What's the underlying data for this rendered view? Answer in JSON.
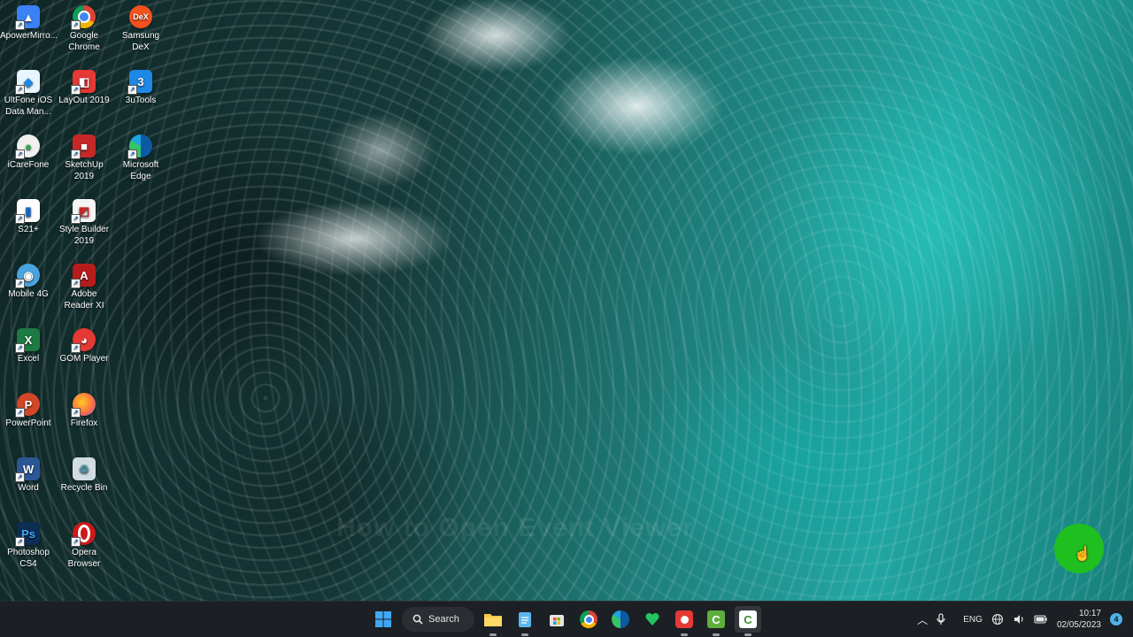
{
  "desktop": {
    "icons": [
      {
        "label": "ApowerMirro...",
        "icon": "apowermirror-icon"
      },
      {
        "label": "Google Chrome",
        "icon": "chrome-icon"
      },
      {
        "label": "Samsung DeX",
        "icon": "samsung-dex-icon"
      },
      {
        "label": "UltFone iOS Data Man...",
        "icon": "ultfone-icon"
      },
      {
        "label": "LayOut 2019",
        "icon": "layout-icon"
      },
      {
        "label": "3uTools",
        "icon": "3utools-icon"
      },
      {
        "label": "iCareFone",
        "icon": "icarefone-icon"
      },
      {
        "label": "SketchUp 2019",
        "icon": "sketchup-icon"
      },
      {
        "label": "Microsoft Edge",
        "icon": "edge-icon"
      },
      {
        "label": "S21+",
        "icon": "s21-icon"
      },
      {
        "label": "Style Builder 2019",
        "icon": "style-builder-icon"
      },
      {
        "label": "Mobile 4G",
        "icon": "mobile-4g-icon"
      },
      {
        "label": "Adobe Reader XI",
        "icon": "adobe-reader-icon"
      },
      {
        "label": "Excel",
        "icon": "excel-icon"
      },
      {
        "label": "GOM Player",
        "icon": "gom-player-icon"
      },
      {
        "label": "PowerPoint",
        "icon": "powerpoint-icon"
      },
      {
        "label": "Firefox",
        "icon": "firefox-icon"
      },
      {
        "label": "Word",
        "icon": "word-icon"
      },
      {
        "label": "Recycle Bin",
        "icon": "recycle-bin-icon"
      },
      {
        "label": "Photoshop CS4",
        "icon": "photoshop-icon"
      },
      {
        "label": "Opera Browser",
        "icon": "opera-icon"
      }
    ],
    "watermark": "How to Open Event Viewer"
  },
  "taskbar": {
    "search_label": "Search",
    "language": "ENG",
    "time": "10:17",
    "date": "02/05/2023",
    "notification_count": "4"
  },
  "colors": {
    "taskbar_bg": "#1c1f23",
    "cursor_highlight": "#1fbf1f",
    "accent_blue": "#0078d4"
  }
}
